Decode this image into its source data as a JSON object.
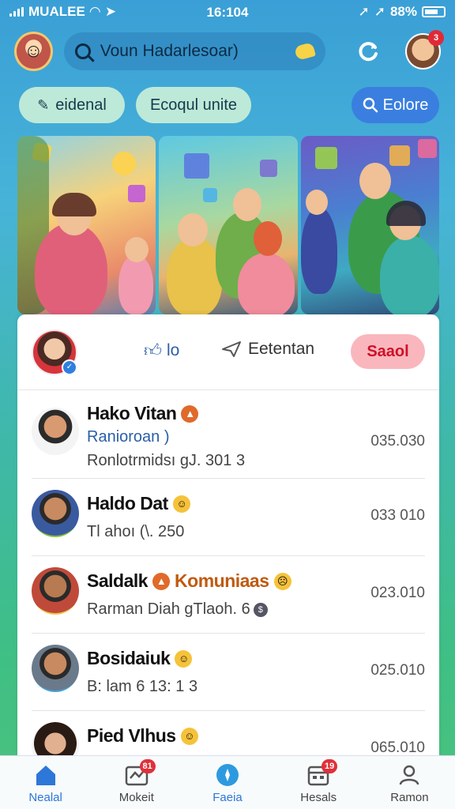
{
  "status_bar": {
    "carrier": "MUALEE",
    "time": "16:104",
    "battery": "88%"
  },
  "header": {
    "search_placeholder": "Voun Hadarlesoar)",
    "profile_badge": "3"
  },
  "filters": [
    {
      "label": "eidenal"
    },
    {
      "label": "Ecoqul unite"
    },
    {
      "label": "Eolore"
    }
  ],
  "card_header": {
    "like_label": "lo",
    "share_label": "Eetentan",
    "action_label": "Saaol"
  },
  "rows": [
    {
      "name": "Hako Vitan",
      "sub_1": "Ranioroan )",
      "sub_2": "Ronlotrmidsı gJ. 301 3",
      "value": "035.030"
    },
    {
      "name": "Haldo Dat",
      "sub_1": "Tl ahoı (\\. 250",
      "value": "033 010"
    },
    {
      "name": "Saldalk",
      "tag": "Komuniaas",
      "sub_1": "Rarman Diah gTlaoh. 6",
      "value": "023.010"
    },
    {
      "name": "Bosidaiuk",
      "sub_1": "B: lam 6 13: 1 3",
      "value": "025.010"
    },
    {
      "name": "Pied Vlhus",
      "value": "065.010"
    }
  ],
  "bottom_nav": [
    {
      "label": "Nealal",
      "badge": ""
    },
    {
      "label": "Mokeit",
      "badge": "81"
    },
    {
      "label": "Faeia",
      "badge": ""
    },
    {
      "label": "Hesals",
      "badge": "19"
    },
    {
      "label": "Ramon",
      "badge": ""
    }
  ],
  "colors": {
    "accent": "#2d77d8",
    "action_pink": "#f9b7bd",
    "badge_red": "#e0303a"
  }
}
